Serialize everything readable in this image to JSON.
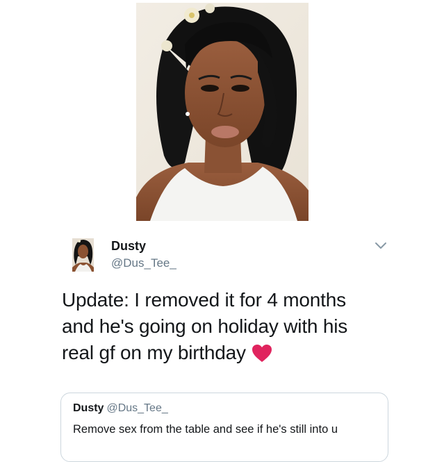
{
  "tweet": {
    "display_name": "Dusty",
    "handle": "@Dus_Tee_",
    "text_lines": [
      "Update: I removed it for 4 months",
      "and he's going on holiday with his",
      "real gf on my birthday"
    ],
    "emoji_icon": "red-heart-icon",
    "menu_icon": "chevron-down-icon"
  },
  "quoted_tweet": {
    "display_name": "Dusty",
    "handle": "@Dus_Tee_",
    "text": "Remove sex from the table and see if he's still into u"
  },
  "photo": {
    "subject": "selfie-photo"
  },
  "colors": {
    "text_primary": "#14171a",
    "text_secondary": "#657786",
    "border": "#ccd6dd",
    "heart": "#e0245e"
  }
}
